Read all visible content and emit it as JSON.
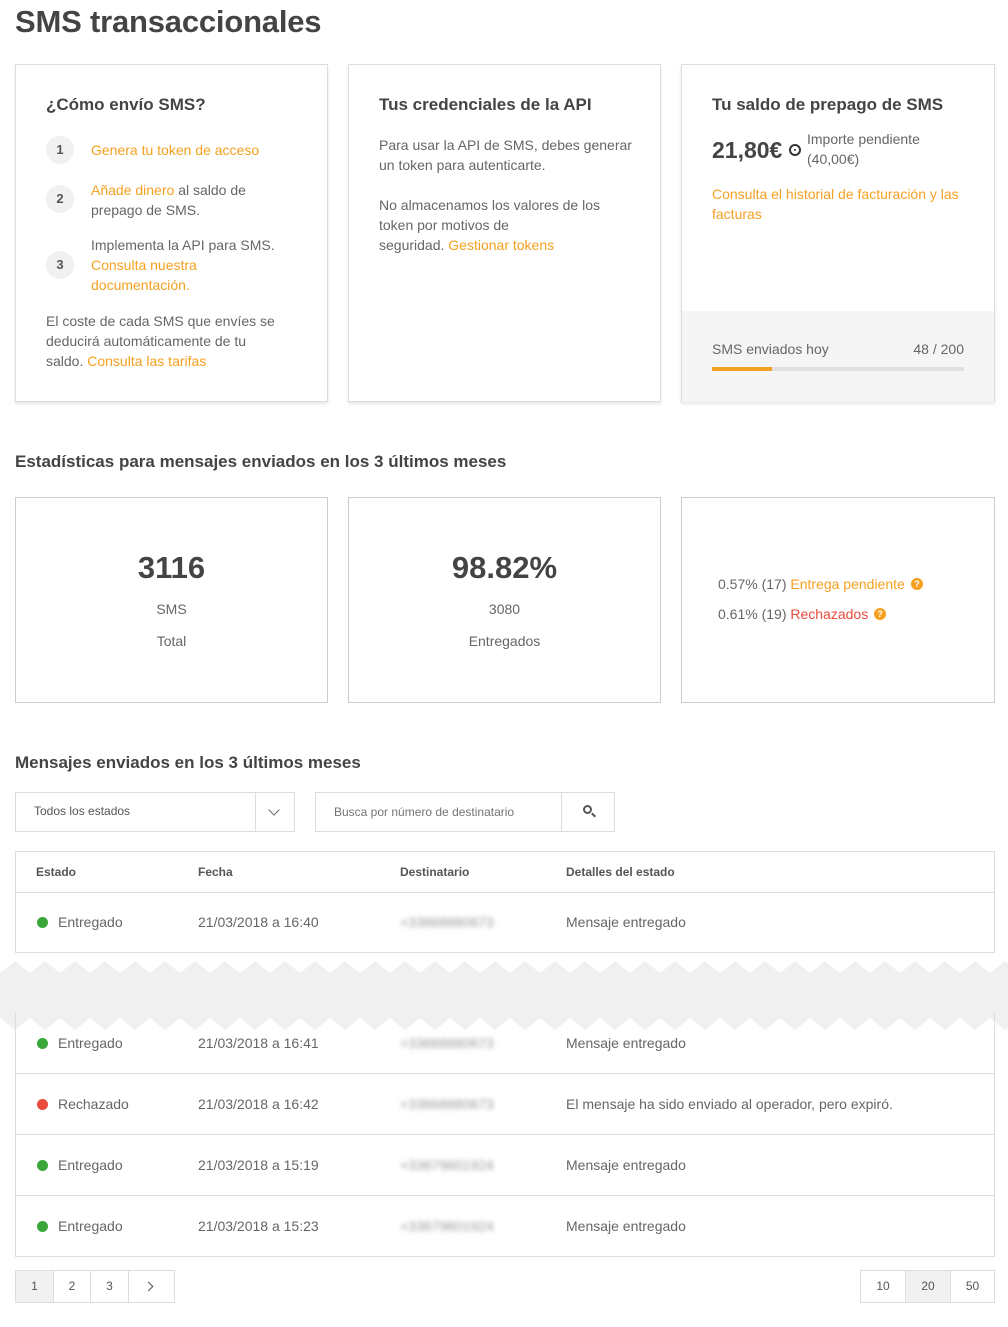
{
  "page": {
    "title": "SMS transaccionales"
  },
  "how_to": {
    "title": "¿Cómo envío SMS?",
    "steps": [
      {
        "number": "1",
        "link": "Genera tu token de acceso"
      },
      {
        "number": "2",
        "link": "Añade dinero",
        "text": "al saldo de",
        "text2": "prepago de SMS."
      },
      {
        "number": "3",
        "text": "Implementa la API para SMS.",
        "link": "Consulta nuestra",
        "link2": "documentación."
      }
    ],
    "note_line1": "El coste de cada SMS que envíes se",
    "note_line2": "deducirá automáticamente de tu",
    "note_line3": "saldo.",
    "note_link": "Consulta las tarifas"
  },
  "credentials": {
    "title": "Tus credenciales de la API",
    "p1_line1": "Para usar la API de SMS, debes generar",
    "p1_line2": "un token para autenticarte.",
    "p2_line1": "No almacenamos los valores de los",
    "p2_line2": "token por motivos de",
    "p2_line3": "seguridad.",
    "p2_link": "Gestionar tokens"
  },
  "balance": {
    "title": "Tu saldo de prepago de SMS",
    "amount": "21,80€",
    "pending_label": "Importe pendiente",
    "pending_value": "(40,00€)",
    "history_link_line1": "Consulta el historial de facturación y las",
    "history_link_line2": "facturas",
    "sent_today_label": "SMS enviados hoy",
    "sent_today_value": "48 / 200",
    "sent_today_fraction": 0.24
  },
  "stats": {
    "title": "Estadísticas para mensajes enviados en los 3 últimos meses",
    "total": {
      "value": "3116",
      "unit": "SMS",
      "label": "Total"
    },
    "delivered": {
      "value": "98.82%",
      "count": "3080",
      "label": "Entregados"
    },
    "pending": {
      "value": "0.57% (17)",
      "label": "Entrega pendiente"
    },
    "rejected": {
      "value": "0.61% (19)",
      "label": "Rechazados"
    }
  },
  "messages": {
    "title": "Mensajes enviados en los 3 últimos meses",
    "filter_selected": "Todos los estados",
    "search_placeholder": "Busca por número de destinatario",
    "columns": [
      "Estado",
      "Fecha",
      "Destinatario",
      "Detalles del estado"
    ],
    "rows": [
      {
        "status": "Entregado",
        "date": "21/03/2018 a 16:40",
        "recipient": "+33668880673",
        "details": "Mensaje entregado"
      },
      {
        "status": "Entregado",
        "date": "21/03/2018 a 16:41",
        "recipient": "+33668880673",
        "details": "Mensaje entregado"
      },
      {
        "status": "Rechazado",
        "date": "21/03/2018 a 16:42",
        "recipient": "+33668880673",
        "details": "El mensaje ha sido enviado al operador, pero expiró."
      },
      {
        "status": "Entregado",
        "date": "21/03/2018 a 15:19",
        "recipient": "+33679601924",
        "details": "Mensaje entregado"
      },
      {
        "status": "Entregado",
        "date": "21/03/2018 a 15:23",
        "recipient": "+33679601924",
        "details": "Mensaje entregado"
      }
    ]
  },
  "pagination": {
    "pages": [
      "1",
      "2",
      "3"
    ],
    "page_sizes": [
      "10",
      "20",
      "50"
    ]
  },
  "colors": {
    "accent": "#f5a020",
    "success": "#3aa63a",
    "danger": "#e94b3c"
  },
  "icons": [
    "clock-icon",
    "chevron-down-icon",
    "search-icon",
    "help-icon",
    "chevron-right-icon"
  ]
}
